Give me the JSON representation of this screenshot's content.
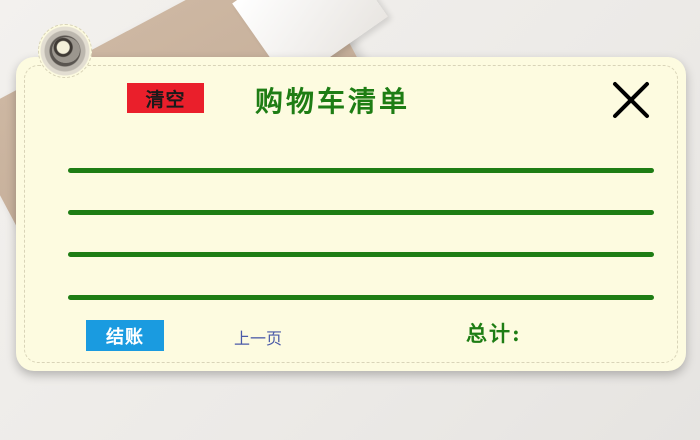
{
  "cart": {
    "title": "购物车清单",
    "clear_label": "清空",
    "checkout_label": "结账",
    "prev_page_label": "上一页",
    "total_label": "总计:",
    "items": [
      "",
      "",
      "",
      ""
    ]
  },
  "colors": {
    "card_background": "#fdfbe0",
    "accent_green": "#1e7d14",
    "clear_red": "#ea1f2b",
    "checkout_blue": "#1a9be0",
    "link_blue": "#4a5aa8"
  },
  "icons": {
    "close": "close-icon",
    "grommet": "grommet-icon"
  }
}
